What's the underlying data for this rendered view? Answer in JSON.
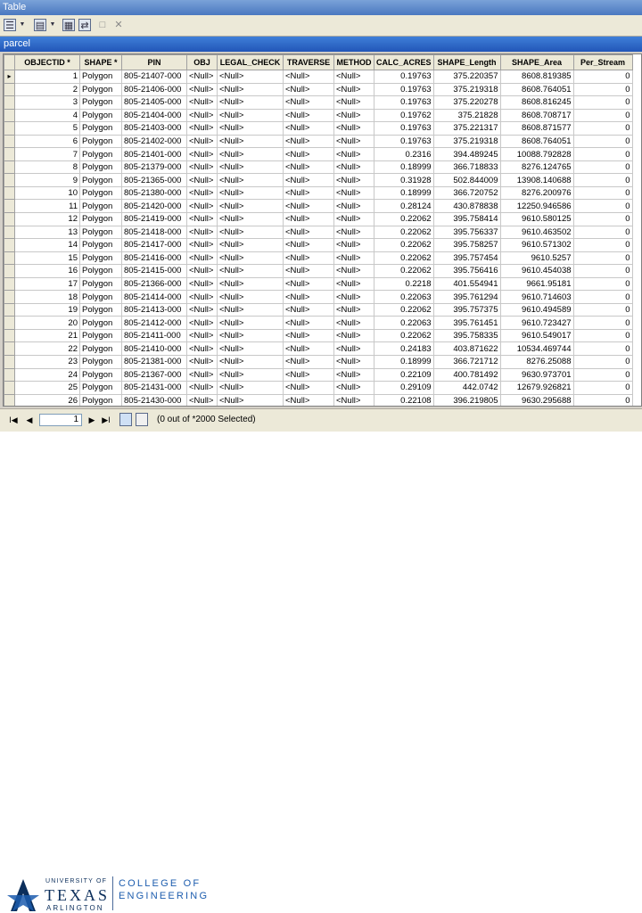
{
  "window": {
    "title": "Table"
  },
  "toolbar": {
    "icons": [
      "table-options-icon",
      "related-tables-icon",
      "select-by-attributes-icon",
      "switch-selection-icon",
      "clear-selection-icon",
      "delete-selected-icon"
    ],
    "delete_glyph": "✕"
  },
  "tab": {
    "name": "parcel"
  },
  "table": {
    "columns": [
      "OBJECTID *",
      "SHAPE *",
      "PIN",
      "OBJ",
      "LEGAL_CHECK",
      "TRAVERSE",
      "METHOD",
      "CALC_ACRES",
      "SHAPE_Length",
      "SHAPE_Area",
      "Per_Stream"
    ],
    "row_marker": "▸",
    "rows": [
      [
        "1",
        "Polygon",
        "805-21407-000",
        "<Null>",
        "<Null>",
        "<Null>",
        "<Null>",
        "0.19763",
        "375.220357",
        "8608.819385",
        "0"
      ],
      [
        "2",
        "Polygon",
        "805-21406-000",
        "<Null>",
        "<Null>",
        "<Null>",
        "<Null>",
        "0.19763",
        "375.219318",
        "8608.764051",
        "0"
      ],
      [
        "3",
        "Polygon",
        "805-21405-000",
        "<Null>",
        "<Null>",
        "<Null>",
        "<Null>",
        "0.19763",
        "375.220278",
        "8608.816245",
        "0"
      ],
      [
        "4",
        "Polygon",
        "805-21404-000",
        "<Null>",
        "<Null>",
        "<Null>",
        "<Null>",
        "0.19762",
        "375.21828",
        "8608.708717",
        "0"
      ],
      [
        "5",
        "Polygon",
        "805-21403-000",
        "<Null>",
        "<Null>",
        "<Null>",
        "<Null>",
        "0.19763",
        "375.221317",
        "8608.871577",
        "0"
      ],
      [
        "6",
        "Polygon",
        "805-21402-000",
        "<Null>",
        "<Null>",
        "<Null>",
        "<Null>",
        "0.19763",
        "375.219318",
        "8608.764051",
        "0"
      ],
      [
        "7",
        "Polygon",
        "805-21401-000",
        "<Null>",
        "<Null>",
        "<Null>",
        "<Null>",
        "0.2316",
        "394.489245",
        "10088.792828",
        "0"
      ],
      [
        "8",
        "Polygon",
        "805-21379-000",
        "<Null>",
        "<Null>",
        "<Null>",
        "<Null>",
        "0.18999",
        "366.718833",
        "8276.124765",
        "0"
      ],
      [
        "9",
        "Polygon",
        "805-21365-000",
        "<Null>",
        "<Null>",
        "<Null>",
        "<Null>",
        "0.31928",
        "502.844009",
        "13908.140688",
        "0"
      ],
      [
        "10",
        "Polygon",
        "805-21380-000",
        "<Null>",
        "<Null>",
        "<Null>",
        "<Null>",
        "0.18999",
        "366.720752",
        "8276.200976",
        "0"
      ],
      [
        "11",
        "Polygon",
        "805-21420-000",
        "<Null>",
        "<Null>",
        "<Null>",
        "<Null>",
        "0.28124",
        "430.878838",
        "12250.946586",
        "0"
      ],
      [
        "12",
        "Polygon",
        "805-21419-000",
        "<Null>",
        "<Null>",
        "<Null>",
        "<Null>",
        "0.22062",
        "395.758414",
        "9610.580125",
        "0"
      ],
      [
        "13",
        "Polygon",
        "805-21418-000",
        "<Null>",
        "<Null>",
        "<Null>",
        "<Null>",
        "0.22062",
        "395.756337",
        "9610.463502",
        "0"
      ],
      [
        "14",
        "Polygon",
        "805-21417-000",
        "<Null>",
        "<Null>",
        "<Null>",
        "<Null>",
        "0.22062",
        "395.758257",
        "9610.571302",
        "0"
      ],
      [
        "15",
        "Polygon",
        "805-21416-000",
        "<Null>",
        "<Null>",
        "<Null>",
        "<Null>",
        "0.22062",
        "395.757454",
        "9610.5257",
        "0"
      ],
      [
        "16",
        "Polygon",
        "805-21415-000",
        "<Null>",
        "<Null>",
        "<Null>",
        "<Null>",
        "0.22062",
        "395.756416",
        "9610.454038",
        "0"
      ],
      [
        "17",
        "Polygon",
        "805-21366-000",
        "<Null>",
        "<Null>",
        "<Null>",
        "<Null>",
        "0.2218",
        "401.554941",
        "9661.95181",
        "0"
      ],
      [
        "18",
        "Polygon",
        "805-21414-000",
        "<Null>",
        "<Null>",
        "<Null>",
        "<Null>",
        "0.22063",
        "395.761294",
        "9610.714603",
        "0"
      ],
      [
        "19",
        "Polygon",
        "805-21413-000",
        "<Null>",
        "<Null>",
        "<Null>",
        "<Null>",
        "0.22062",
        "395.757375",
        "9610.494589",
        "0"
      ],
      [
        "20",
        "Polygon",
        "805-21412-000",
        "<Null>",
        "<Null>",
        "<Null>",
        "<Null>",
        "0.22063",
        "395.761451",
        "9610.723427",
        "0"
      ],
      [
        "21",
        "Polygon",
        "805-21411-000",
        "<Null>",
        "<Null>",
        "<Null>",
        "<Null>",
        "0.22062",
        "395.758335",
        "9610.549017",
        "0"
      ],
      [
        "22",
        "Polygon",
        "805-21410-000",
        "<Null>",
        "<Null>",
        "<Null>",
        "<Null>",
        "0.24183",
        "403.871622",
        "10534.469744",
        "0"
      ],
      [
        "23",
        "Polygon",
        "805-21381-000",
        "<Null>",
        "<Null>",
        "<Null>",
        "<Null>",
        "0.18999",
        "366.721712",
        "8276.25088",
        "0"
      ],
      [
        "24",
        "Polygon",
        "805-21367-000",
        "<Null>",
        "<Null>",
        "<Null>",
        "<Null>",
        "0.22109",
        "400.781492",
        "9630.973701",
        "0"
      ],
      [
        "25",
        "Polygon",
        "805-21431-000",
        "<Null>",
        "<Null>",
        "<Null>",
        "<Null>",
        "0.29109",
        "442.0742",
        "12679.926821",
        "0"
      ],
      [
        "26",
        "Polygon",
        "805-21430-000",
        "<Null>",
        "<Null>",
        "<Null>",
        "<Null>",
        "0.22108",
        "396.219805",
        "9630.295688",
        "0"
      ]
    ]
  },
  "navigation": {
    "first": "I◀",
    "prev": "◀",
    "next": "▶",
    "last": "▶I",
    "current_record": "1",
    "status": "(0 out of *2000 Selected)"
  },
  "branding": {
    "university_of": "UNIVERSITY OF",
    "texas": "TEXAS",
    "arlington": "ARLINGTON",
    "college_of": "COLLEGE OF",
    "engineering": "ENGINEERING",
    "colors": {
      "navy": "#0b2e5b",
      "blue": "#1c5cae"
    }
  }
}
